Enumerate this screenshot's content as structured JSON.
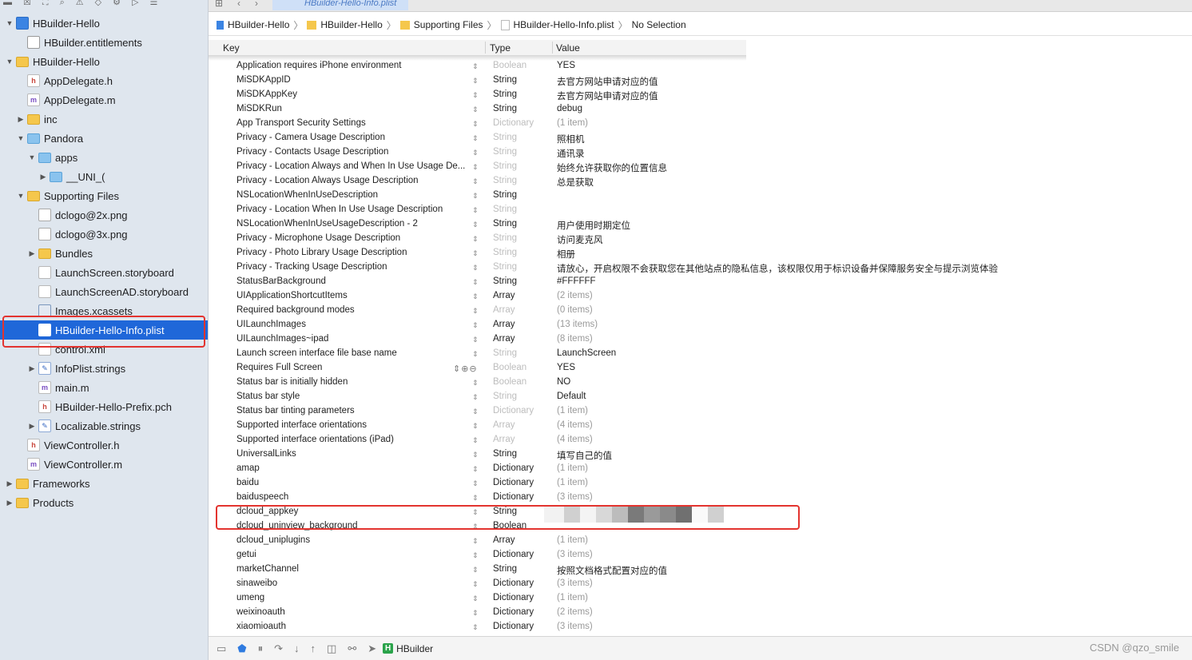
{
  "navigator": {
    "items": [
      {
        "label": "HBuilder-Hello",
        "depth": 0,
        "icon": "project-icon",
        "disc": "open"
      },
      {
        "label": "HBuilder.entitlements",
        "depth": 1,
        "icon": "entitlements-icon",
        "disc": ""
      },
      {
        "label": "HBuilder-Hello",
        "depth": 0,
        "icon": "folder-icon",
        "disc": "open"
      },
      {
        "label": "AppDelegate.h",
        "depth": 1,
        "icon": "header-file-icon",
        "disc": ""
      },
      {
        "label": "AppDelegate.m",
        "depth": 1,
        "icon": "objc-file-icon",
        "disc": ""
      },
      {
        "label": "inc",
        "depth": 1,
        "icon": "folder-icon",
        "disc": "closed"
      },
      {
        "label": "Pandora",
        "depth": 1,
        "icon": "blue-folder-icon",
        "disc": "open"
      },
      {
        "label": "apps",
        "depth": 2,
        "icon": "blue-folder-icon",
        "disc": "open"
      },
      {
        "label": "__UNI_(",
        "depth": 3,
        "icon": "blue-folder-icon",
        "disc": "closed"
      },
      {
        "label": "Supporting Files",
        "depth": 1,
        "icon": "folder-icon",
        "disc": "open"
      },
      {
        "label": "dclogo@2x.png",
        "depth": 2,
        "icon": "image-file-icon",
        "disc": ""
      },
      {
        "label": "dclogo@3x.png",
        "depth": 2,
        "icon": "image-file-icon",
        "disc": ""
      },
      {
        "label": "Bundles",
        "depth": 2,
        "icon": "folder-icon",
        "disc": "closed"
      },
      {
        "label": "LaunchScreen.storyboard",
        "depth": 2,
        "icon": "storyboard-icon",
        "disc": ""
      },
      {
        "label": "LaunchScreenAD.storyboard",
        "depth": 2,
        "icon": "storyboard-icon",
        "disc": ""
      },
      {
        "label": "Images.xcassets",
        "depth": 2,
        "icon": "xcassets-icon",
        "disc": ""
      },
      {
        "label": "HBuilder-Hello-Info.plist",
        "depth": 2,
        "icon": "plist-file-icon",
        "disc": "",
        "selected": true
      },
      {
        "label": "control.xml",
        "depth": 2,
        "icon": "xml-file-icon",
        "disc": ""
      },
      {
        "label": "InfoPlist.strings",
        "depth": 2,
        "icon": "strings-file-icon",
        "disc": "closed"
      },
      {
        "label": "main.m",
        "depth": 2,
        "icon": "objc-file-icon",
        "disc": ""
      },
      {
        "label": "HBuilder-Hello-Prefix.pch",
        "depth": 2,
        "icon": "header-file-icon",
        "disc": ""
      },
      {
        "label": "Localizable.strings",
        "depth": 2,
        "icon": "strings-file-icon",
        "disc": "closed"
      },
      {
        "label": "ViewController.h",
        "depth": 1,
        "icon": "header-file-icon",
        "disc": ""
      },
      {
        "label": "ViewController.m",
        "depth": 1,
        "icon": "objc-file-icon",
        "disc": ""
      },
      {
        "label": "Frameworks",
        "depth": 0,
        "icon": "folder-icon",
        "disc": "closed"
      },
      {
        "label": "Products",
        "depth": 0,
        "icon": "folder-icon",
        "disc": "closed"
      }
    ]
  },
  "tab": {
    "active_label": "HBuilder-Hello-Info.plist"
  },
  "jumpbar": {
    "items": [
      "HBuilder-Hello",
      "HBuilder-Hello",
      "Supporting Files",
      "HBuilder-Hello-Info.plist",
      "No Selection"
    ]
  },
  "columns": {
    "key": "Key",
    "type": "Type",
    "value": "Value"
  },
  "rows": [
    {
      "key": "Application requires iPhone environment",
      "type": "Boolean",
      "type_dim": true,
      "value": "YES"
    },
    {
      "key": "MiSDKAppID",
      "type": "String",
      "value": "去官方网站申请对应的值"
    },
    {
      "key": "MiSDKAppKey",
      "type": "String",
      "value": "去官方网站申请对应的值"
    },
    {
      "key": "MiSDKRun",
      "type": "String",
      "value": "debug"
    },
    {
      "key": "App Transport Security Settings",
      "exp": true,
      "type": "Dictionary",
      "type_dim": true,
      "value": "(1 item)",
      "value_dim": true
    },
    {
      "key": "Privacy - Camera Usage Description",
      "type": "String",
      "type_dim": true,
      "value": "照相机"
    },
    {
      "key": "Privacy - Contacts Usage Description",
      "type": "String",
      "type_dim": true,
      "value": "通讯录"
    },
    {
      "key": "Privacy - Location Always and When In Use Usage De...",
      "type": "String",
      "type_dim": true,
      "value": "始终允许获取你的位置信息"
    },
    {
      "key": "Privacy - Location Always Usage Description",
      "type": "String",
      "type_dim": true,
      "value": "总是获取"
    },
    {
      "key": "NSLocationWhenInUseDescription",
      "type": "String",
      "value": ""
    },
    {
      "key": "Privacy - Location When In Use Usage Description",
      "type": "String",
      "type_dim": true,
      "value": ""
    },
    {
      "key": "NSLocationWhenInUseUsageDescription - 2",
      "type": "String",
      "value": "用户使用时期定位"
    },
    {
      "key": "Privacy - Microphone Usage Description",
      "type": "String",
      "type_dim": true,
      "value": "访问麦克风"
    },
    {
      "key": "Privacy - Photo Library Usage Description",
      "type": "String",
      "type_dim": true,
      "value": "相册"
    },
    {
      "key": "Privacy - Tracking Usage Description",
      "type": "String",
      "type_dim": true,
      "value": "请放心，开启权限不会获取您在其他站点的隐私信息，该权限仅用于标识设备并保障服务安全与提示浏览体验"
    },
    {
      "key": "StatusBarBackground",
      "type": "String",
      "value": "#FFFFFF"
    },
    {
      "key": "UIApplicationShortcutItems",
      "exp": true,
      "type": "Array",
      "value": "(2 items)",
      "value_dim": true
    },
    {
      "key": "Required background modes",
      "exp": true,
      "type": "Array",
      "type_dim": true,
      "value": "(0 items)",
      "value_dim": true
    },
    {
      "key": "UILaunchImages",
      "exp": true,
      "type": "Array",
      "value": "(13 items)",
      "value_dim": true
    },
    {
      "key": "UILaunchImages~ipad",
      "exp": true,
      "type": "Array",
      "value": "(8 items)",
      "value_dim": true
    },
    {
      "key": "Launch screen interface file base name",
      "type": "String",
      "type_dim": true,
      "value": "LaunchScreen"
    },
    {
      "key": "Requires Full Screen",
      "type": "Boolean",
      "type_dim": true,
      "value": "YES",
      "pm": true
    },
    {
      "key": "Status bar is initially hidden",
      "type": "Boolean",
      "type_dim": true,
      "value": "NO"
    },
    {
      "key": "Status bar style",
      "type": "String",
      "type_dim": true,
      "value": "Default"
    },
    {
      "key": "Status bar tinting parameters",
      "exp": true,
      "type": "Dictionary",
      "type_dim": true,
      "value": "(1 item)",
      "value_dim": true
    },
    {
      "key": "Supported interface orientations",
      "exp": true,
      "type": "Array",
      "type_dim": true,
      "value": "(4 items)",
      "value_dim": true
    },
    {
      "key": "Supported interface orientations (iPad)",
      "exp": true,
      "type": "Array",
      "type_dim": true,
      "value": "(4 items)",
      "value_dim": true
    },
    {
      "key": "UniversalLinks",
      "type": "String",
      "value": "填写自己的值"
    },
    {
      "key": "amap",
      "exp": true,
      "type": "Dictionary",
      "value": "(1 item)",
      "value_dim": true
    },
    {
      "key": "baidu",
      "exp": true,
      "type": "Dictionary",
      "value": "(1 item)",
      "value_dim": true
    },
    {
      "key": "baiduspeech",
      "exp": true,
      "type": "Dictionary",
      "value": "(3 items)",
      "value_dim": true
    },
    {
      "key": "dcloud_appkey",
      "type": "String",
      "value": ""
    },
    {
      "key": "dcloud_uninview_background",
      "type": "Boolean",
      "value": ""
    },
    {
      "key": "dcloud_uniplugins",
      "exp": true,
      "type": "Array",
      "value": "(1 item)",
      "value_dim": true
    },
    {
      "key": "getui",
      "exp": true,
      "type": "Dictionary",
      "value": "(3 items)",
      "value_dim": true
    },
    {
      "key": "marketChannel",
      "type": "String",
      "value": "按照文档格式配置对应的值"
    },
    {
      "key": "sinaweibo",
      "exp": true,
      "type": "Dictionary",
      "value": "(3 items)",
      "value_dim": true
    },
    {
      "key": "umeng",
      "exp": true,
      "type": "Dictionary",
      "value": "(1 item)",
      "value_dim": true
    },
    {
      "key": "weixinoauth",
      "exp": true,
      "type": "Dictionary",
      "value": "(2 items)",
      "value_dim": true
    },
    {
      "key": "xiaomioauth",
      "exp": true,
      "type": "Dictionary",
      "value": "(3 items)",
      "value_dim": true
    }
  ],
  "debugbar": {
    "scheme": "HBuilder"
  },
  "watermark": "CSDN @qzo_smile",
  "colors": {
    "selection": "#1f67d9",
    "highlight": "#e3342f",
    "sidebar": "#dfe6ee"
  }
}
